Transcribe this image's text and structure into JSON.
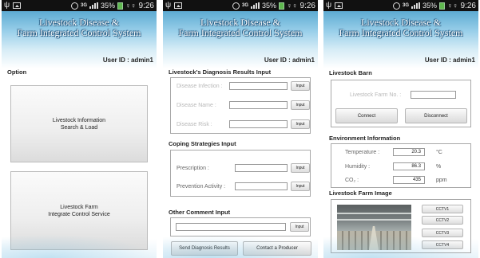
{
  "status_bar": {
    "battery": "35%",
    "time": "9:26",
    "network": "3G"
  },
  "app": {
    "title_line1": "Livestock Disease &",
    "title_line2": "Farm Integrated Control System",
    "user_id": "User ID : admin1"
  },
  "screen1": {
    "section": "Option",
    "btn1_line1": "Livestock Information",
    "btn1_line2": "Search & Load",
    "btn2_line1": "Livestock Farm",
    "btn2_line2": "Integrate Control Service"
  },
  "screen2": {
    "section_diagnosis": "Livestock's Diagnosis Results Input",
    "disease_infection_label": "Disease Infection :",
    "disease_name_label": "Disease Name :",
    "disease_risk_label": "Disease Risk :",
    "input_label": "Input",
    "section_coping": "Coping Strategies Input",
    "prescription_label": "Prescription :",
    "prevention_label": "Prevention Activity :",
    "section_comment": "Other Comment Input",
    "send_button": "Send Diagnosis Results",
    "contact_button": "Contact a Producer"
  },
  "screen3": {
    "section_barn": "Livestock Barn",
    "farm_no_label": "Livestock Farm No. :",
    "connect_button": "Connect",
    "disconnect_button": "Disconnect",
    "section_env": "Environment Information",
    "temperature_label": "Temperature :",
    "temperature_value": "20.3",
    "temperature_unit": "°C",
    "humidity_label": "Humidity :",
    "humidity_value": "86.3",
    "humidity_unit": "%",
    "co2_label": "CO₂ :",
    "co2_value": "435",
    "co2_unit": "ppm",
    "section_image": "Livestock Farm Image",
    "cctv": [
      "CCTV1",
      "CCTV2",
      "CCTV3",
      "CCTV4"
    ]
  }
}
